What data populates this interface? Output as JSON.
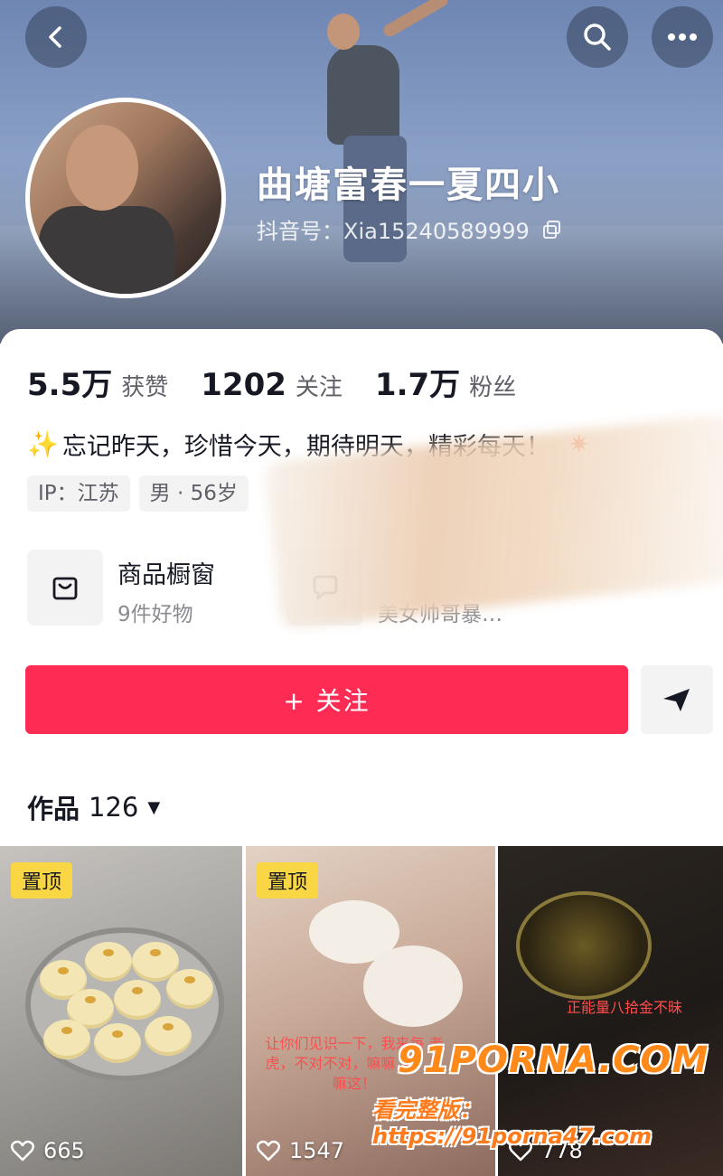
{
  "profile": {
    "username": "曲塘富春一夏四小",
    "douyin_id_label": "抖音号：",
    "douyin_id": "Xia15240589999"
  },
  "stats": [
    {
      "value": "5.5万",
      "label": "获赞"
    },
    {
      "value": "1202",
      "label": "关注"
    },
    {
      "value": "1.7万",
      "label": "粉丝"
    }
  ],
  "bio": {
    "text": "忘记昨天，珍惜今天，期待明天，精彩每天！"
  },
  "tags": [
    "IP：江苏",
    "男 · 56岁"
  ],
  "shop": {
    "title": "商品橱窗",
    "subtitle": "9件好物"
  },
  "group": {
    "subtitle": "美女帅哥暴…"
  },
  "actions": {
    "follow_label": "+ 关注"
  },
  "works": {
    "label": "作品",
    "count": "126"
  },
  "videos": [
    {
      "pinned_label": "置顶",
      "likes": "665"
    },
    {
      "pinned_label": "置顶",
      "likes": "1547",
      "overlay": "让你们见识一下，我来每 老虎，不对不对，嘛嘛 了，看嘛这！"
    },
    {
      "likes": "778",
      "overlay": "正能量八拾金不昧"
    }
  ],
  "watermark": {
    "line1": "91PORNA.COM",
    "line2": "看完整版：https://91porna47.com"
  },
  "colors": {
    "accent": "#fe2c55",
    "pin_badge": "#f9d644",
    "text_primary": "#161823",
    "text_secondary": "#5f6068"
  }
}
